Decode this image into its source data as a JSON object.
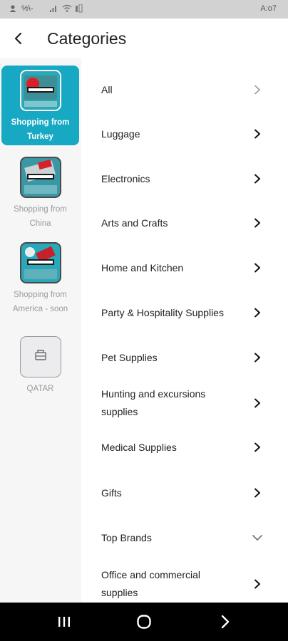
{
  "status_bar": {
    "left_text": "%\\-",
    "time": "A:o7"
  },
  "header": {
    "back_icon": "back-arrow-icon",
    "title": "Categories"
  },
  "sidebar": {
    "items": [
      {
        "label": "Shopping from Turkey",
        "active": true,
        "icon": "turkey-store-image"
      },
      {
        "label": "Shopping from China",
        "active": false,
        "icon": "china-store-image"
      },
      {
        "label": "Shopping from America - soon",
        "active": false,
        "icon": "america-store-image"
      },
      {
        "label": "QATAR",
        "active": false,
        "icon": "qatar-store-icon"
      }
    ]
  },
  "categories": [
    {
      "label": "All",
      "icon": "chevron-right-icon"
    },
    {
      "label": "Luggage",
      "icon": "chevron-right-icon"
    },
    {
      "label": "Electronics",
      "icon": "chevron-right-icon"
    },
    {
      "label": "Arts and Crafts",
      "icon": "chevron-right-icon"
    },
    {
      "label": "Home and Kitchen",
      "icon": "chevron-right-icon"
    },
    {
      "label": "Party & Hospitality Supplies",
      "icon": "chevron-right-icon"
    },
    {
      "label": "Pet Supplies",
      "icon": "chevron-right-icon"
    },
    {
      "label": "Hunting and excursions supplies",
      "icon": "chevron-right-icon"
    },
    {
      "label": "Medical Supplies",
      "icon": "chevron-right-icon"
    },
    {
      "label": "Gifts",
      "icon": "chevron-right-icon"
    },
    {
      "label": "Top Brands",
      "icon": "chevron-down-icon"
    },
    {
      "label": "Office and commercial supplies",
      "icon": "chevron-right-icon"
    }
  ],
  "nav_bar": {
    "recents_icon": "recents-icon",
    "home_icon": "home-icon",
    "back_icon": "nav-back-icon"
  },
  "colors": {
    "accent": "#17a8c3",
    "sidebar_bg": "#f6f6f6",
    "status_bar_bg": "#d2d2d2",
    "nav_bar_bg": "#000000"
  }
}
